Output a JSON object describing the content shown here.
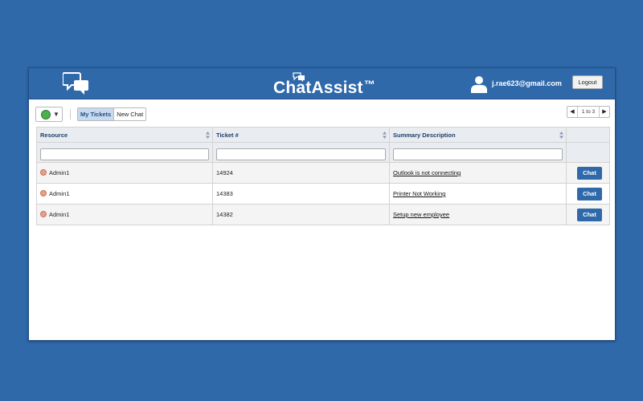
{
  "header": {
    "app_name": "ChatAssist",
    "trademark": "™",
    "user_email": "j.rae623@gmail.com",
    "logout_label": "Logout"
  },
  "toolbar": {
    "status_color": "#4caf50",
    "tabs": [
      {
        "label": "My Tickets",
        "active": true
      },
      {
        "label": "New Chat",
        "active": false
      }
    ],
    "pager_text": "1 to 3"
  },
  "table": {
    "columns": [
      "Resource",
      "Ticket #",
      "Summary Description",
      ""
    ],
    "rows": [
      {
        "resource": "Admin1",
        "ticket": "14924",
        "summary": "Outlook is not connecting",
        "action": "Chat"
      },
      {
        "resource": "Admin1",
        "ticket": "14383",
        "summary": "Printer Not Working",
        "action": "Chat"
      },
      {
        "resource": "Admin1",
        "ticket": "14382",
        "summary": "Setup new employee",
        "action": "Chat"
      }
    ]
  },
  "colors": {
    "background": "#2f69aa",
    "accent": "#2f69aa",
    "status_online": "#4caf50",
    "resource_dot": "#e6a08a"
  }
}
